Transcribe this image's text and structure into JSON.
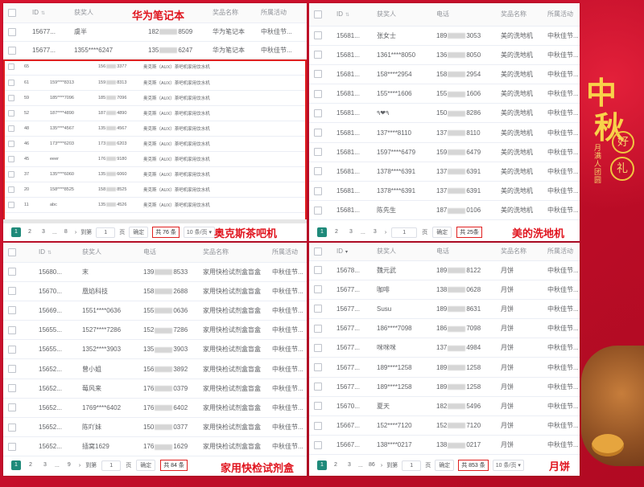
{
  "labels": {
    "huawei": "华为笔记本",
    "aux": "奥克斯茶吧机",
    "midea": "美的洗地机",
    "testkit": "家用快检试剂盒",
    "mooncake": "月饼"
  },
  "decor": {
    "mid": "中",
    "autumn": "秋",
    "good": "好",
    "gift": "礼",
    "vertical1": "月满人团圆"
  },
  "columns": {
    "id": "ID",
    "winner": "获奖人",
    "phone": "电话",
    "prize": "奖品名称",
    "activity": "所属活动"
  },
  "huawei": {
    "rows": [
      {
        "id": "15677...",
        "winner": "虞半",
        "phone_a": "182",
        "phone_b": "8509",
        "prize": "华为笔记本",
        "activity": "中秋佳节..."
      },
      {
        "id": "15677...",
        "winner": "1355****6247",
        "phone_a": "135",
        "phone_b": "6247",
        "prize": "华为笔记本",
        "activity": "中秋佳节..."
      }
    ]
  },
  "aux": {
    "rows": [
      {
        "id": "65",
        "winner": "",
        "phone_a": "156",
        "phone_b": "3377",
        "prize": "奥克斯（AUX）茶吧机家用饮水机"
      },
      {
        "id": "61",
        "winner": "159****8313",
        "phone_a": "159",
        "phone_b": "8313",
        "prize": "奥克斯（AUX）茶吧机家用饮水机"
      },
      {
        "id": "59",
        "winner": "185****7096",
        "phone_a": "185",
        "phone_b": "7096",
        "prize": "奥克斯（AUX）茶吧机家用饮水机"
      },
      {
        "id": "52",
        "winner": "187****4890",
        "phone_a": "187",
        "phone_b": "4890",
        "prize": "奥克斯（AUX）茶吧机家用饮水机"
      },
      {
        "id": "48",
        "winner": "135****4567",
        "phone_a": "135",
        "phone_b": "4567",
        "prize": "奥克斯（AUX）茶吧机家用饮水机"
      },
      {
        "id": "46",
        "winner": "173****6203",
        "phone_a": "173",
        "phone_b": "6203",
        "prize": "奥克斯（AUX）茶吧机家用饮水机"
      },
      {
        "id": "45",
        "winner": "eeer",
        "phone_a": "176",
        "phone_b": "9180",
        "prize": "奥克斯（AUX）茶吧机家用饮水机"
      },
      {
        "id": "37",
        "winner": "135****6060",
        "phone_a": "135",
        "phone_b": "6060",
        "prize": "奥克斯（AUX）茶吧机家用饮水机"
      },
      {
        "id": "20",
        "winner": "158****8525",
        "phone_a": "158",
        "phone_b": "8525",
        "prize": "奥克斯（AUX）茶吧机家用饮水机"
      },
      {
        "id": "11",
        "winner": "abc",
        "phone_a": "135",
        "phone_b": "4526",
        "prize": "奥克斯（AUX）茶吧机家用饮水机"
      }
    ],
    "pager": {
      "p1": "1",
      "p2": "2",
      "p3": "3",
      "dots": "...",
      "plast": "8",
      "goto": "到第",
      "page_input": "1",
      "page_unit": "页",
      "confirm": "确定",
      "total": "共 76 条",
      "size": "10 条/页"
    }
  },
  "midea": {
    "rows": [
      {
        "id": "15681...",
        "winner": "张女士",
        "phone_a": "189",
        "phone_b": "3053",
        "prize": "美的洗地机",
        "activity": "中秋佳节..."
      },
      {
        "id": "15681...",
        "winner": "1361****8050",
        "phone_a": "136",
        "phone_b": "8050",
        "prize": "美的洗地机",
        "activity": "中秋佳节..."
      },
      {
        "id": "15681...",
        "winner": "158****2954",
        "phone_a": "158",
        "phone_b": "2954",
        "prize": "美的洗地机",
        "activity": "中秋佳节..."
      },
      {
        "id": "15681...",
        "winner": "155****1606",
        "phone_a": "155",
        "phone_b": "1606",
        "prize": "美的洗地机",
        "activity": "中秋佳节..."
      },
      {
        "id": "15681...",
        "winner": "٩❤٩",
        "phone_a": "150",
        "phone_b": "8286",
        "prize": "美的洗地机",
        "activity": "中秋佳节..."
      },
      {
        "id": "15681...",
        "winner": "137****8110",
        "phone_a": "137",
        "phone_b": "8110",
        "prize": "美的洗地机",
        "activity": "中秋佳节..."
      },
      {
        "id": "15681...",
        "winner": "1597****6479",
        "phone_a": "159",
        "phone_b": "6479",
        "prize": "美的洗地机",
        "activity": "中秋佳节..."
      },
      {
        "id": "15681...",
        "winner": "1378****6391",
        "phone_a": "137",
        "phone_b": "6391",
        "prize": "美的洗地机",
        "activity": "中秋佳节..."
      },
      {
        "id": "15681...",
        "winner": "1378****6391",
        "phone_a": "137",
        "phone_b": "6391",
        "prize": "美的洗地机",
        "activity": "中秋佳节..."
      },
      {
        "id": "15681...",
        "winner": "陈先生",
        "phone_a": "187",
        "phone_b": "0106",
        "prize": "美的洗地机",
        "activity": "中秋佳节..."
      }
    ],
    "pager": {
      "p1": "1",
      "p2": "2",
      "p3": "3",
      "dots": "...",
      "plast": "3",
      "page_input": "1",
      "page_unit": "页",
      "confirm": "确定",
      "total": "共 25条"
    }
  },
  "testkit": {
    "rows": [
      {
        "id": "15680...",
        "winner": "末",
        "phone_a": "139",
        "phone_b": "8533",
        "prize": "家用快检试剂盒盲盒",
        "activity": "中秋佳节..."
      },
      {
        "id": "15670...",
        "winner": "凰焰科技",
        "phone_a": "158",
        "phone_b": "2688",
        "prize": "家用快检试剂盒盲盒",
        "activity": "中秋佳节..."
      },
      {
        "id": "15669...",
        "winner": "1551****0636",
        "phone_a": "155",
        "phone_b": "0636",
        "prize": "家用快检试剂盒盲盒",
        "activity": "中秋佳节..."
      },
      {
        "id": "15655...",
        "winner": "1527****7286",
        "phone_a": "152",
        "phone_b": "7286",
        "prize": "家用快检试剂盒盲盒",
        "activity": "中秋佳节..."
      },
      {
        "id": "15655...",
        "winner": "1352****3903",
        "phone_a": "135",
        "phone_b": "3903",
        "prize": "家用快检试剂盒盲盒",
        "activity": "中秋佳节..."
      },
      {
        "id": "15652...",
        "winner": "曾小姐",
        "phone_a": "156",
        "phone_b": "3892",
        "prize": "家用快检试剂盒盲盒",
        "activity": "中秋佳节..."
      },
      {
        "id": "15652...",
        "winner": "莓风来",
        "phone_a": "176",
        "phone_b": "0379",
        "prize": "家用快检试剂盒盲盒",
        "activity": "中秋佳节..."
      },
      {
        "id": "15652...",
        "winner": "1769****6402",
        "phone_a": "176",
        "phone_b": "6402",
        "prize": "家用快检试剂盒盲盒",
        "activity": "中秋佳节..."
      },
      {
        "id": "15652...",
        "winner": "陈吖妹",
        "phone_a": "150",
        "phone_b": "0377",
        "prize": "家用快检试剂盒盲盒",
        "activity": "中秋佳节..."
      },
      {
        "id": "15652...",
        "winner": "插窝1629",
        "phone_a": "176",
        "phone_b": "1629",
        "prize": "家用快检试剂盒盲盒",
        "activity": "中秋佳节..."
      }
    ],
    "pager": {
      "p1": "1",
      "p2": "2",
      "p3": "3",
      "dots": "...",
      "plast": "9",
      "goto": "到第",
      "page_input": "1",
      "page_unit": "页",
      "confirm": "确定",
      "total": "共 84 条"
    }
  },
  "mooncake": {
    "rows": [
      {
        "id": "15678...",
        "winner": "魏元武",
        "phone_a": "189",
        "phone_b": "8122",
        "prize": "月饼",
        "activity": "中秋佳节..."
      },
      {
        "id": "15677...",
        "winner": "咖啡",
        "phone_a": "138",
        "phone_b": "0628",
        "prize": "月饼",
        "activity": "中秋佳节..."
      },
      {
        "id": "15677...",
        "winner": "Susu",
        "phone_a": "189",
        "phone_b": "8631",
        "prize": "月饼",
        "activity": "中秋佳节..."
      },
      {
        "id": "15677...",
        "winner": "186****7098",
        "phone_a": "186",
        "phone_b": "7098",
        "prize": "月饼",
        "activity": "中秋佳节..."
      },
      {
        "id": "15677...",
        "winner": "咪咪咪",
        "phone_a": "137",
        "phone_b": "4984",
        "prize": "月饼",
        "activity": "中秋佳节..."
      },
      {
        "id": "15677...",
        "winner": "189****1258",
        "phone_a": "189",
        "phone_b": "1258",
        "prize": "月饼",
        "activity": "中秋佳节..."
      },
      {
        "id": "15677...",
        "winner": "189****1258",
        "phone_a": "189",
        "phone_b": "1258",
        "prize": "月饼",
        "activity": "中秋佳节..."
      },
      {
        "id": "15670...",
        "winner": "夏天",
        "phone_a": "182",
        "phone_b": "5496",
        "prize": "月饼",
        "activity": "中秋佳节..."
      },
      {
        "id": "15667...",
        "winner": "152****7120",
        "phone_a": "152",
        "phone_b": "7120",
        "prize": "月饼",
        "activity": "中秋佳节..."
      },
      {
        "id": "15667...",
        "winner": "138****0217",
        "phone_a": "138",
        "phone_b": "0217",
        "prize": "月饼",
        "activity": "中秋佳节..."
      }
    ],
    "pager": {
      "p1": "1",
      "p2": "2",
      "p3": "3",
      "dots": "...",
      "plast": "86",
      "goto": "到第",
      "page_input": "1",
      "page_unit": "页",
      "confirm": "确定",
      "total": "共 853 条",
      "size": "10 条/页"
    }
  }
}
